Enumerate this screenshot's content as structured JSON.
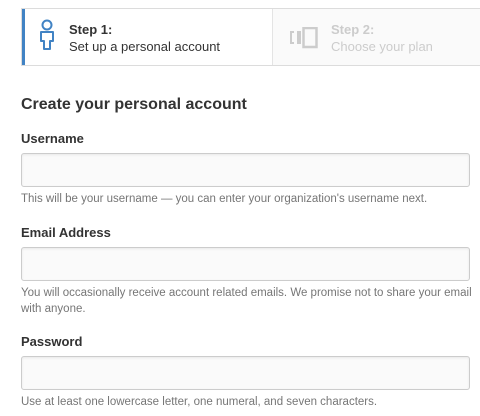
{
  "steps": [
    {
      "title": "Step 1:",
      "subtitle": "Set up a personal account",
      "icon": "person-icon",
      "state": "active"
    },
    {
      "title": "Step 2:",
      "subtitle": "Choose your plan",
      "icon": "plan-icon",
      "state": "inactive"
    }
  ],
  "form": {
    "heading": "Create your personal account",
    "username": {
      "label": "Username",
      "value": "",
      "hint": "This will be your username — you can enter your organization's username next."
    },
    "email": {
      "label": "Email Address",
      "value": "",
      "hint": "You will occasionally receive account related emails. We promise not to share your email with anyone."
    },
    "password": {
      "label": "Password",
      "value": "",
      "hint": "Use at least one lowercase letter, one numeral, and seven characters."
    }
  },
  "colors": {
    "accent": "#4183c4",
    "inactive_text": "#cccccc",
    "hint_text": "#767676"
  }
}
